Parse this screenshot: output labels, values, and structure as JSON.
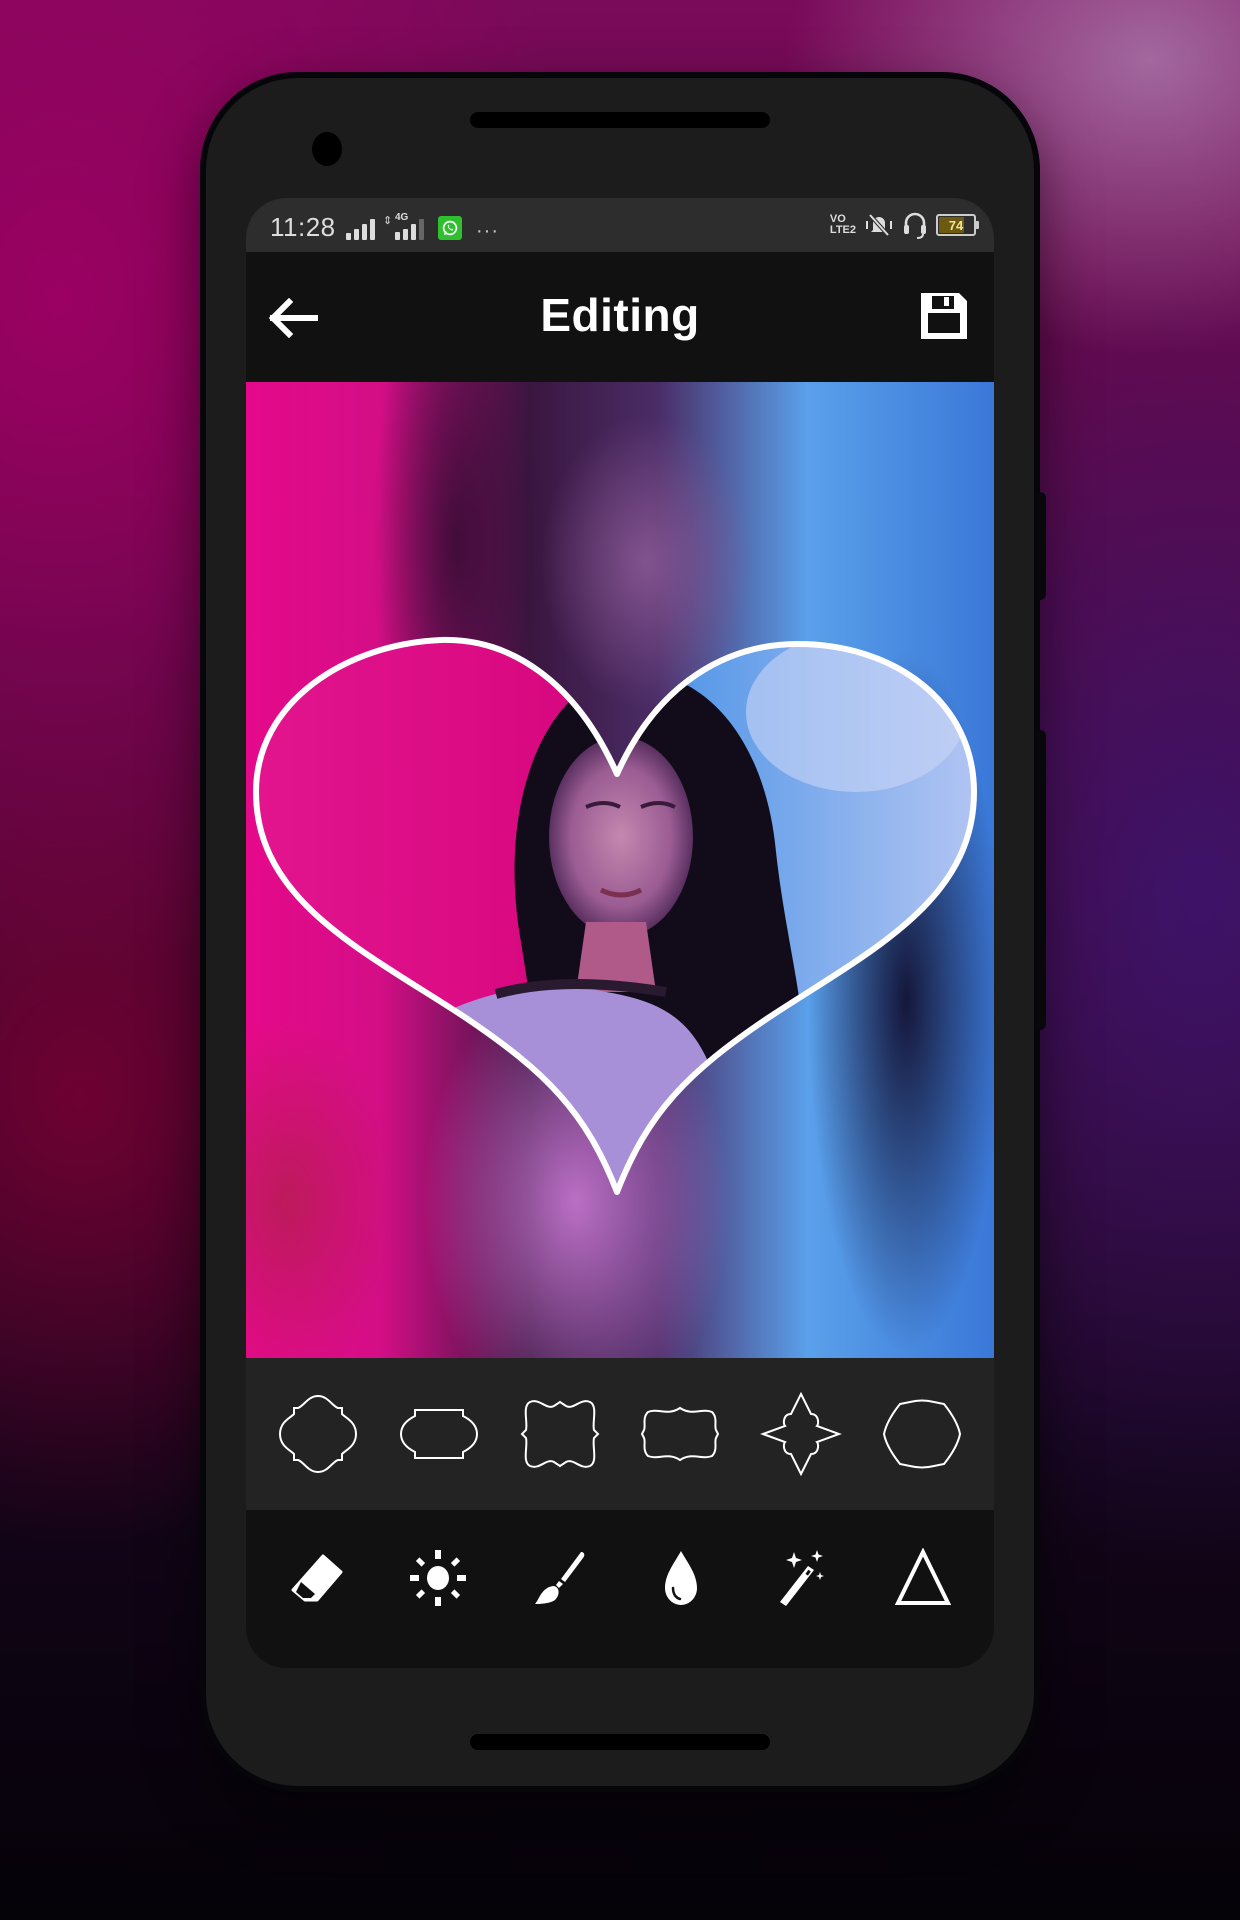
{
  "status_bar": {
    "time": "11:28",
    "network_label": "4G",
    "volte_line1": "VO",
    "volte_line2": "LTE2",
    "battery_percent": 74,
    "battery_label": "74",
    "icons": [
      "signal-icon",
      "mobile-data-4g-icon",
      "whatsapp-notification-icon",
      "more-notifications-icon",
      "volte-icon",
      "vibrate-silent-icon",
      "headset-icon",
      "battery-icon"
    ]
  },
  "app_bar": {
    "title": "Editing",
    "back_icon": "arrow-left-icon",
    "save_icon": "floppy-disk-icon"
  },
  "canvas": {
    "frame_shape": "heart",
    "frame_color": "#ffffff",
    "accent_left": "#e5098a",
    "accent_right": "#5aa0ea"
  },
  "shapes": [
    {
      "name": "ornate-quatrefoil-frame"
    },
    {
      "name": "notched-label-frame"
    },
    {
      "name": "wavy-scalloped-frame"
    },
    {
      "name": "bracket-label-frame"
    },
    {
      "name": "star-pointed-frame"
    },
    {
      "name": "octagon-curved-frame"
    }
  ],
  "tools": [
    {
      "name": "eraser",
      "icon": "eraser-icon"
    },
    {
      "name": "brightness",
      "icon": "sun-icon"
    },
    {
      "name": "brush",
      "icon": "paintbrush-icon"
    },
    {
      "name": "blur",
      "icon": "water-drop-icon"
    },
    {
      "name": "magic",
      "icon": "magic-wand-icon"
    },
    {
      "name": "triangle",
      "icon": "triangle-icon"
    }
  ]
}
